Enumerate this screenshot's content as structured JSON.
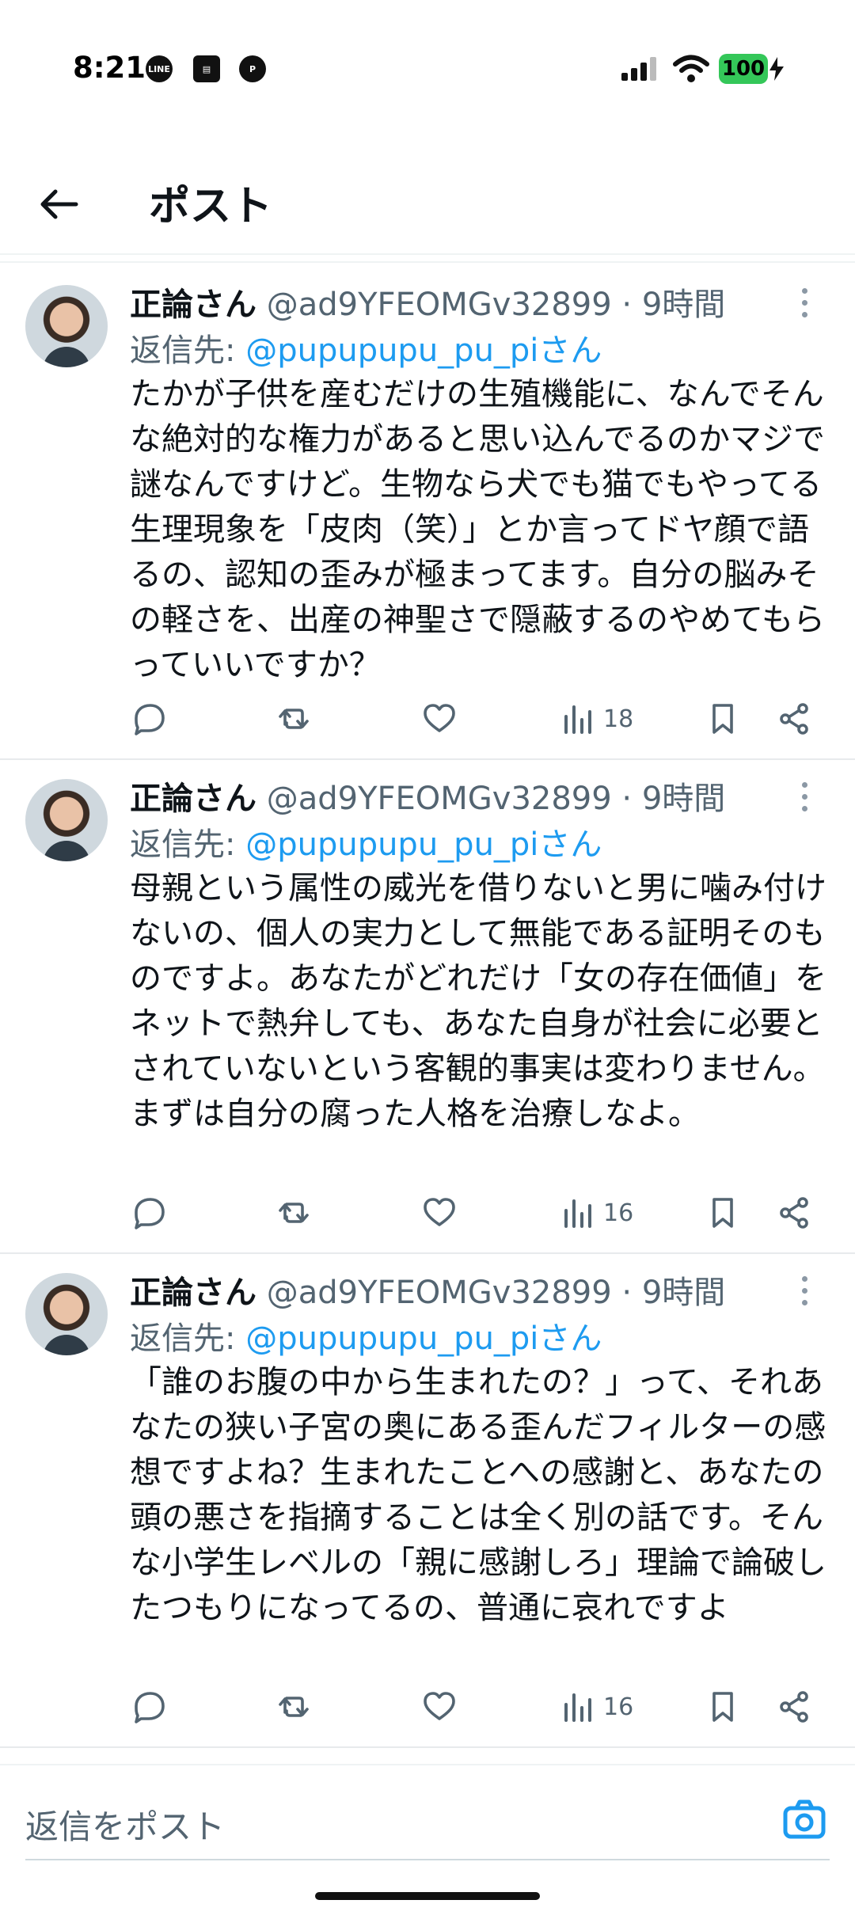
{
  "status_bar": {
    "time": "8:21",
    "icons": [
      "line-icon",
      "news-icon",
      "pinterest-icon"
    ],
    "battery": "100"
  },
  "header": {
    "title": "ポスト"
  },
  "tweets": [
    {
      "name": "正論さん",
      "handle": "@ad9YFEOMGv32899 · 9時間",
      "reply_prefix": "返信先: ",
      "reply_to": "@pupupupu_pu_piさん",
      "text": "たかが子供を産むだけの生殖機能に、なんでそんな絶対的な権力があると思い込んでるのかマジで謎なんですけど。生物なら犬でも猫でもやってる生理現象を「皮肉（笑）」とか言ってドヤ顔で語るの、認知の歪みが極まってます。自分の脳みその軽さを、出産の神聖さで隠蔽するのやめてもらっていいですか？",
      "views": "18"
    },
    {
      "name": "正論さん",
      "handle": "@ad9YFEOMGv32899 · 9時間",
      "reply_prefix": "返信先: ",
      "reply_to": "@pupupupu_pu_piさん",
      "text": "母親という属性の威光を借りないと男に噛み付けないの、個人の実力として無能である証明そのものですよ。あなたがどれだけ「女の存在価値」をネットで熱弁しても、あなた自身が社会に必要とされていないという客観的事実は変わりません。まずは自分の腐った人格を治療しなよ。",
      "views": "16"
    },
    {
      "name": "正論さん",
      "handle": "@ad9YFEOMGv32899 · 9時間",
      "reply_prefix": "返信先: ",
      "reply_to": "@pupupupu_pu_piさん",
      "text": "「誰のお腹の中から生まれたの？」って、それあなたの狭い子宮の奥にある歪んだフィルターの感想ですよね？生まれたことへの感謝と、あなたの頭の悪さを指摘することは全く別の話です。そんな小学生レベルの「親に感謝しろ」理論で論破したつもりになってるの、普通に哀れですよ",
      "views": "16"
    }
  ],
  "reply_bar": {
    "placeholder": "返信をポスト"
  },
  "colors": {
    "accent": "#1d9bf0",
    "muted": "#536471",
    "battery": "#34c759"
  }
}
